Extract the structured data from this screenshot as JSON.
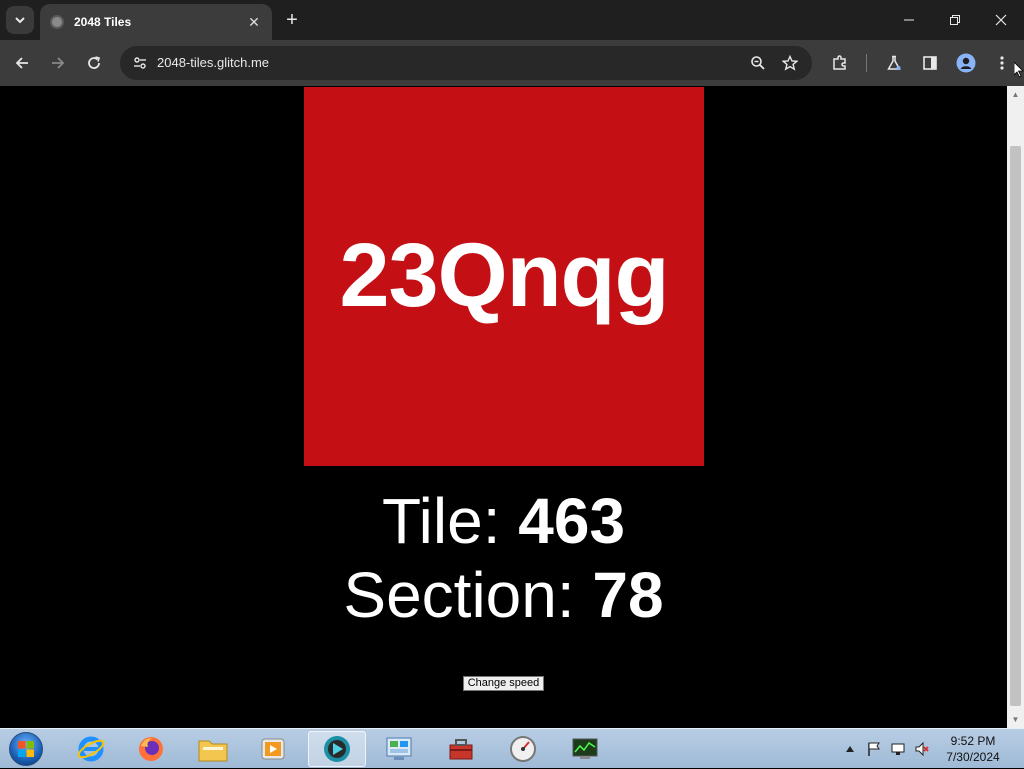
{
  "browser": {
    "tab_title": "2048 Tiles",
    "url": "2048-tiles.glitch.me"
  },
  "page": {
    "tile_word": "23Qnqg",
    "tile_color": "#c41014",
    "tile_label": "Tile: ",
    "tile_value": "463",
    "section_label": "Section: ",
    "section_value": "78",
    "button_label": "Change speed"
  },
  "taskbar": {
    "time": "9:52 PM",
    "date": "7/30/2024",
    "apps": [
      "internet-explorer",
      "firefox",
      "file-explorer",
      "media-player",
      "active-app",
      "control-panel",
      "toolbox",
      "speed-test",
      "task-manager"
    ]
  }
}
